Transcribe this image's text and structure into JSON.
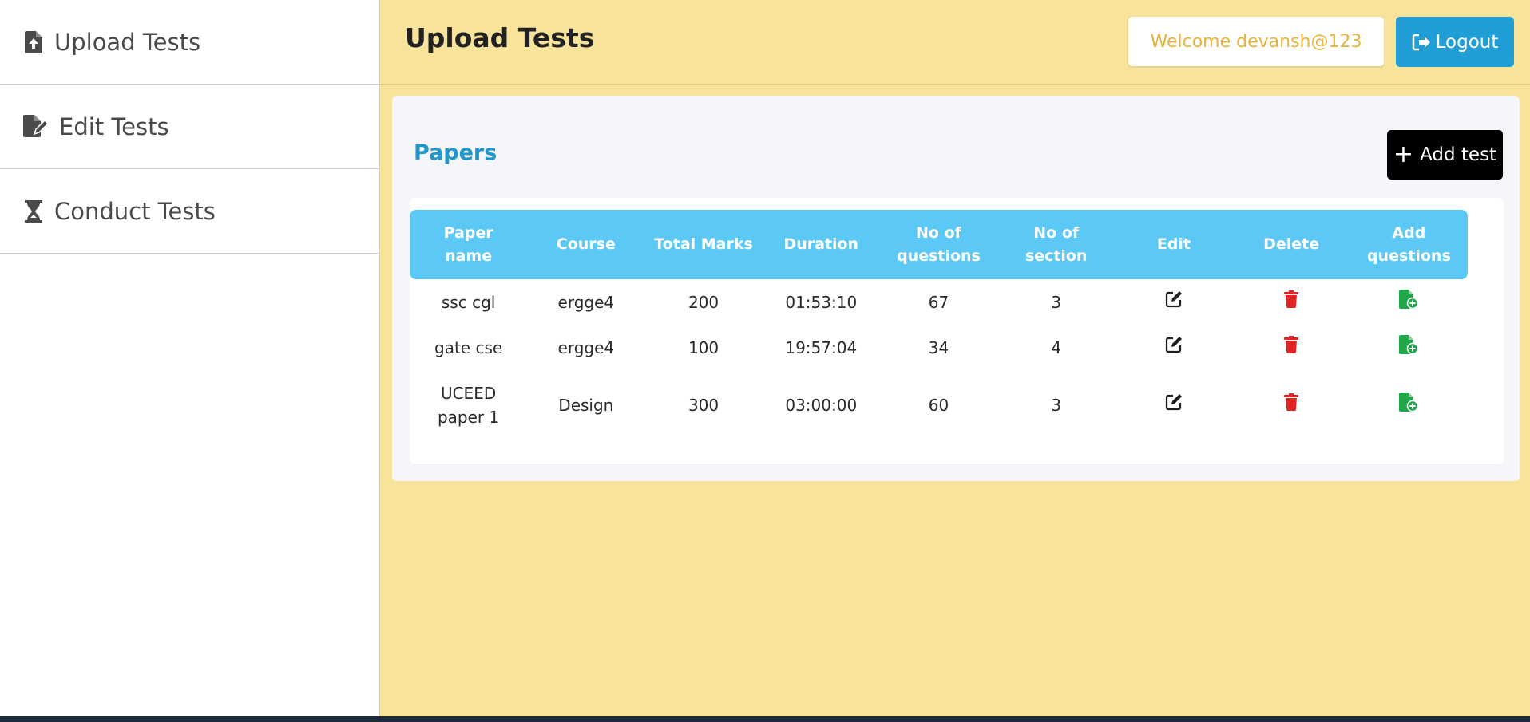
{
  "sidebar": {
    "items": [
      {
        "label": "Upload Tests",
        "icon": "file-upload-icon"
      },
      {
        "label": "Edit Tests",
        "icon": "file-edit-icon"
      },
      {
        "label": "Conduct Tests",
        "icon": "hourglass-icon"
      }
    ]
  },
  "header": {
    "title": "Upload Tests",
    "welcome": "Welcome devansh@123",
    "logout": "Logout"
  },
  "papers": {
    "title": "Papers",
    "add_button": "Add test",
    "columns": [
      "Paper\nname",
      "Course",
      "Total Marks",
      "Duration",
      "No of\nquestions",
      "No of\nsection",
      "Edit",
      "Delete",
      "Add\nquestions"
    ],
    "rows": [
      {
        "name": "ssc cgl",
        "course": "ergge4",
        "marks": "200",
        "duration": "01:53:10",
        "questions": "67",
        "sections": "3"
      },
      {
        "name": "gate cse",
        "course": "ergge4",
        "marks": "100",
        "duration": "19:57:04",
        "questions": "34",
        "sections": "4"
      },
      {
        "name": "UCEED\npaper 1",
        "course": "Design",
        "marks": "300",
        "duration": "03:00:00",
        "questions": "60",
        "sections": "3"
      }
    ]
  },
  "colors": {
    "main_bg": "#f8e39b",
    "accent_blue": "#2196c9",
    "table_header": "#5bc8f5",
    "delete_red": "#e02424",
    "add_green": "#1ea84a",
    "welcome_text": "#e8b43a"
  }
}
